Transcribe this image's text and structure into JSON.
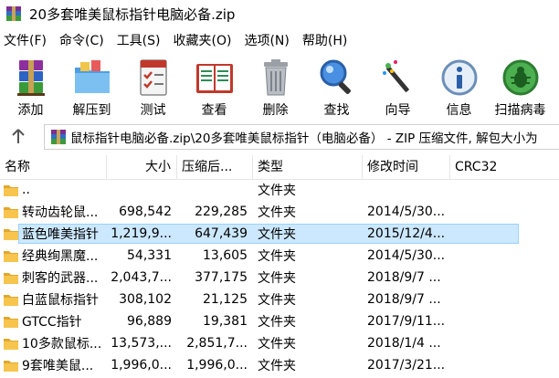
{
  "window": {
    "title": "20多套唯美鼠标指针电脑必备.zip"
  },
  "menu": [
    "文件(F)",
    "命令(C)",
    "工具(S)",
    "收藏夹(O)",
    "选项(N)",
    "帮助(H)"
  ],
  "toolbar": [
    {
      "label": "添加",
      "icon": "add-books-icon"
    },
    {
      "label": "解压到",
      "icon": "extract-folder-icon"
    },
    {
      "label": "测试",
      "icon": "test-checklist-icon"
    },
    {
      "label": "查看",
      "icon": "view-book-icon"
    },
    {
      "label": "删除",
      "icon": "trash-icon"
    },
    {
      "label": "查找",
      "icon": "magnifier-icon"
    },
    {
      "label": "向导",
      "icon": "wizard-wand-icon"
    },
    {
      "label": "信息",
      "icon": "info-icon"
    },
    {
      "label": "扫描病毒",
      "icon": "virus-scan-icon"
    }
  ],
  "address": {
    "text": "鼠标指针电脑必备.zip\\20多套唯美鼠标指针（电脑必备） - ZIP 压缩文件, 解包大小为"
  },
  "columns": {
    "name": "名称",
    "size": "大小",
    "compressed": "压缩后...",
    "type": "类型",
    "modified": "修改时间",
    "crc": "CRC32"
  },
  "rows": [
    {
      "name": "..",
      "size": "",
      "compressed": "",
      "type": "文件夹",
      "modified": ""
    },
    {
      "name": "转动齿轮鼠...",
      "size": "698,542",
      "compressed": "229,285",
      "type": "文件夹",
      "modified": "2014/5/30..."
    },
    {
      "name": "蓝色唯美指针",
      "size": "1,219,9...",
      "compressed": "647,439",
      "type": "文件夹",
      "modified": "2015/12/4..."
    },
    {
      "name": "经典绚黑魔...",
      "size": "54,331",
      "compressed": "13,605",
      "type": "文件夹",
      "modified": "2014/5/30..."
    },
    {
      "name": "刺客的武器...",
      "size": "2,043,7...",
      "compressed": "377,175",
      "type": "文件夹",
      "modified": "2018/9/7 ..."
    },
    {
      "name": "白蓝鼠标指针",
      "size": "308,102",
      "compressed": "21,125",
      "type": "文件夹",
      "modified": "2018/9/7 ..."
    },
    {
      "name": "GTCC指针",
      "size": "96,889",
      "compressed": "19,381",
      "type": "文件夹",
      "modified": "2017/9/11..."
    },
    {
      "name": "10多款鼠标...",
      "size": "13,573,...",
      "compressed": "2,851,7...",
      "type": "文件夹",
      "modified": "2018/1/4 ..."
    },
    {
      "name": "9套唯美鼠...",
      "size": "1,996,0...",
      "compressed": "1,996,0...",
      "type": "文件夹",
      "modified": "2017/3/21..."
    }
  ],
  "selected_row": 2
}
